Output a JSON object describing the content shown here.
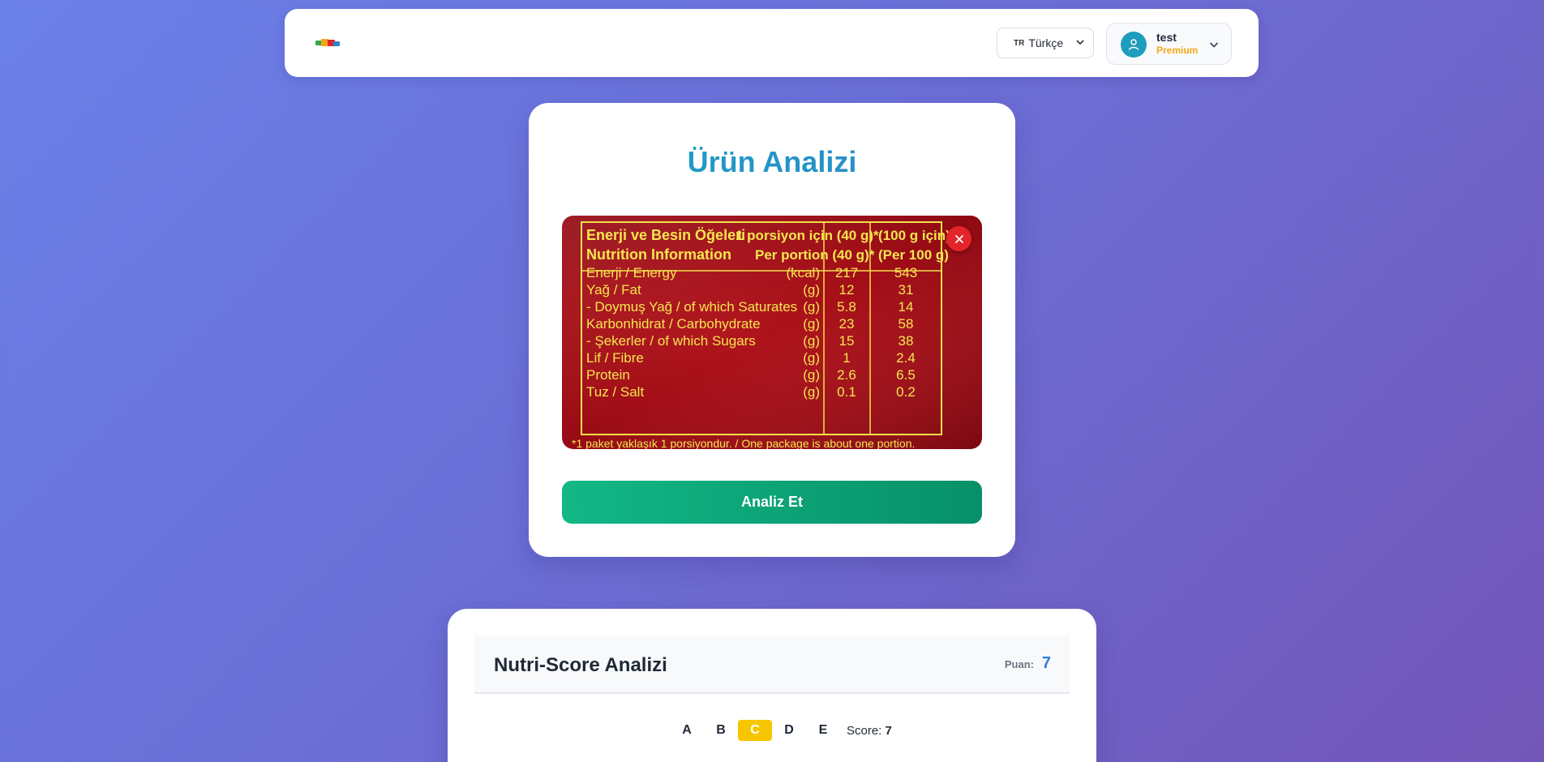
{
  "header": {
    "language": {
      "flag": "TR",
      "label": "Türkçe"
    },
    "user": {
      "name": "test",
      "plan": "Premium"
    }
  },
  "analysis": {
    "title": "Ürün Analizi",
    "analyze_label": "Analiz Et",
    "label_image": {
      "header": {
        "left_tr": "Enerji ve Besin Öğeleri",
        "left_en": "Nutrition Information",
        "per_portion_tr": "1 porsiyon için (40 g)*",
        "per_portion_en": "Per portion (40 g)*",
        "per100_tr": "(100 g için)",
        "per100_en": "(Per 100 g)"
      },
      "rows": [
        {
          "name": "Enerji / Energy",
          "unit": "(kcal)",
          "portion": "217",
          "per100": "543"
        },
        {
          "name": "Yağ / Fat",
          "unit": "(g)",
          "portion": "12",
          "per100": "31"
        },
        {
          "name": "- Doymuş Yağ / of which Saturates",
          "unit": "(g)",
          "portion": "5.8",
          "per100": "14"
        },
        {
          "name": "Karbonhidrat / Carbohydrate",
          "unit": "(g)",
          "portion": "23",
          "per100": "58"
        },
        {
          "name": "- Şekerler / of which Sugars",
          "unit": "(g)",
          "portion": "15",
          "per100": "38"
        },
        {
          "name": "Lif / Fibre",
          "unit": "(g)",
          "portion": "1",
          "per100": "2.4"
        },
        {
          "name": "Protein",
          "unit": "(g)",
          "portion": "2.6",
          "per100": "6.5"
        },
        {
          "name": "Tuz / Salt",
          "unit": "(g)",
          "portion": "0.1",
          "per100": "0.2"
        }
      ],
      "footnote": "*1 paket yaklaşık 1 porsiyondur. / One package is about one portion."
    }
  },
  "nutriscore": {
    "title": "Nutri-Score Analizi",
    "points_label": "Puan:",
    "points_value": "7",
    "grades": [
      "A",
      "B",
      "C",
      "D",
      "E"
    ],
    "active_grade": "C",
    "score_label": "Score:",
    "score_value": "7",
    "active_color": "#f7c600"
  }
}
